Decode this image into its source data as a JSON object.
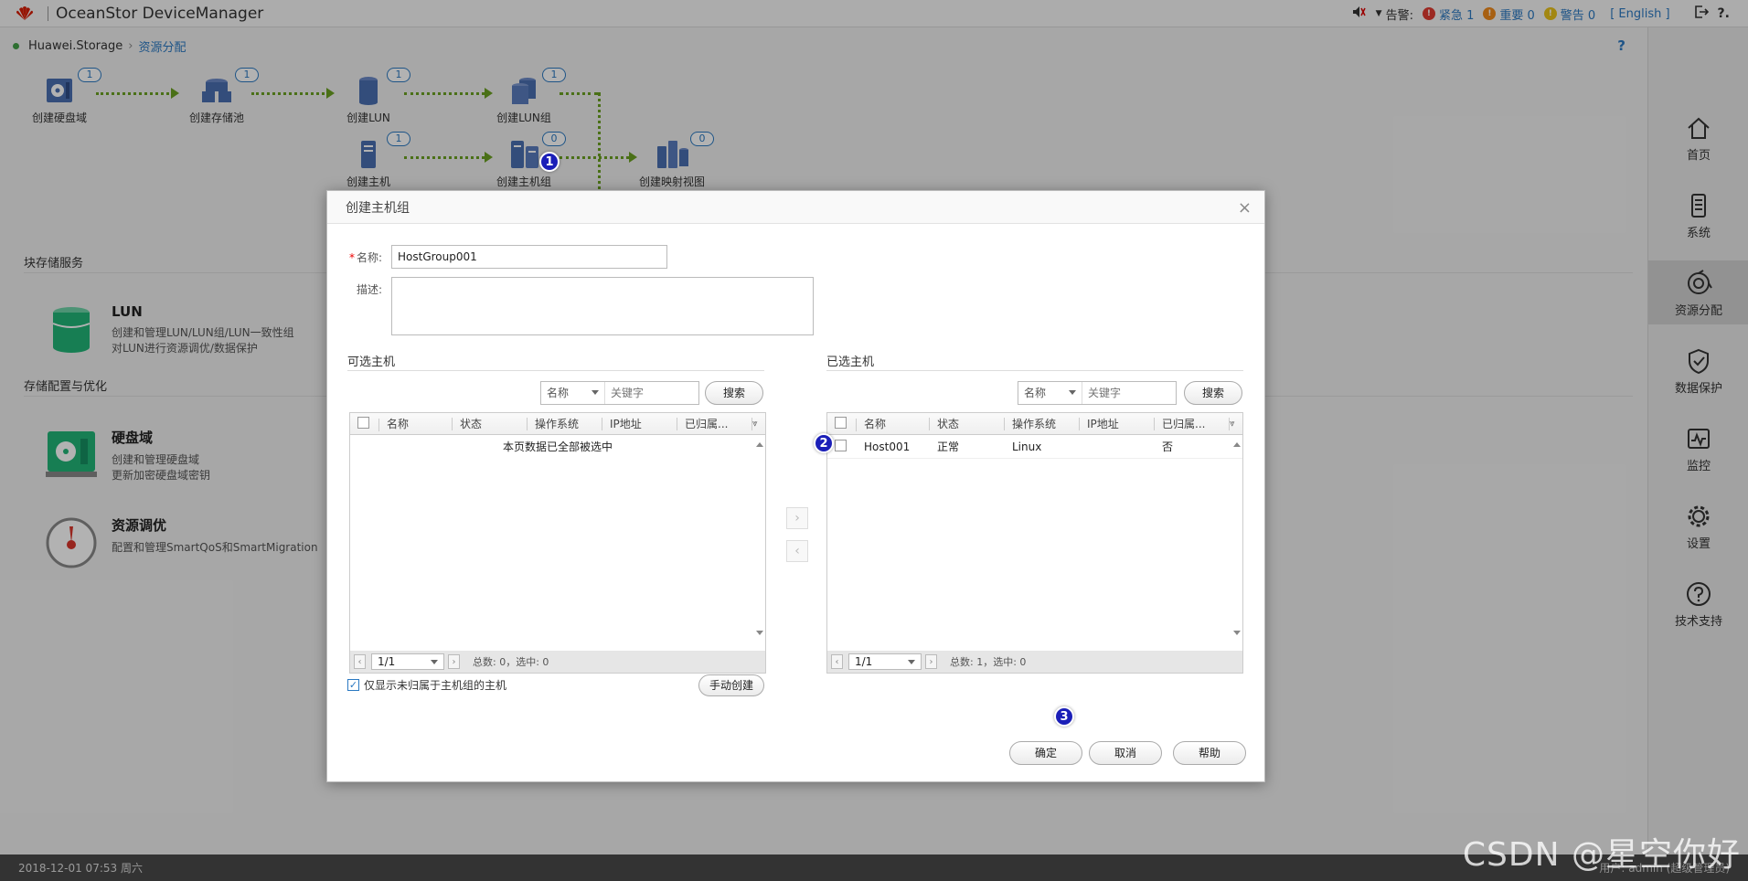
{
  "header": {
    "app_title": "OceanStor DeviceManager",
    "alarm_label": "告警:",
    "critical_label": "紧急 1",
    "major_label": "重要 0",
    "warning_label": "警告 0",
    "language_label": "[ English ]"
  },
  "breadcrumb": {
    "root": "Huawei.Storage",
    "current": "资源分配",
    "help": "?"
  },
  "flow": {
    "nodes": [
      {
        "label": "创建硬盘域",
        "count": "1"
      },
      {
        "label": "创建存储池",
        "count": "1"
      },
      {
        "label": "创建LUN",
        "count": "1"
      },
      {
        "label": "创建LUN组",
        "count": "1"
      },
      {
        "label": "创建主机",
        "count": "1"
      },
      {
        "label": "创建主机组",
        "count": "0"
      },
      {
        "label": "创建映射视图",
        "count": "0"
      }
    ]
  },
  "services": {
    "block_title": "块存储服务",
    "lun_name": "LUN",
    "lun_desc1": "创建和管理LUN/LUN组/LUN一致性组",
    "lun_desc2": "对LUN进行资源调优/数据保护",
    "config_title": "存储配置与优化",
    "disk_name": "硬盘域",
    "disk_desc1": "创建和管理硬盘域",
    "disk_desc2": "更新加密硬盘域密钥",
    "tune_name": "资源调优",
    "tune_desc1": "配置和管理SmartQoS和SmartMigration"
  },
  "sidebar": {
    "items": [
      {
        "label": "首页"
      },
      {
        "label": "系统"
      },
      {
        "label": "资源分配"
      },
      {
        "label": "数据保护"
      },
      {
        "label": "监控"
      },
      {
        "label": "设置"
      },
      {
        "label": "技术支持"
      }
    ]
  },
  "footer": {
    "datetime": "2018-12-01 07:53 周六",
    "user": "用户: admin (超级管理员)"
  },
  "dialog": {
    "title": "创建主机组",
    "name_label": "名称:",
    "name_value": "HostGroup001",
    "desc_label": "描述:",
    "available_title": "可选主机",
    "selected_title": "已选主机",
    "filter_field": "名称",
    "keyword_placeholder": "关键字",
    "search_btn": "搜索",
    "columns": [
      "名称",
      "状态",
      "操作系统",
      "IP地址",
      "已归属..."
    ],
    "available_empty_msg": "本页数据已全部被选中",
    "available_page": "1/1",
    "available_summary": "总数: 0，选中: 0",
    "selected_rows": [
      {
        "name": "Host001",
        "status": "正常",
        "os": "Linux",
        "ip": "",
        "belongs": "否"
      }
    ],
    "selected_page": "1/1",
    "selected_summary": "总数: 1，选中: 0",
    "only_unassigned_label": "仅显示未归属于主机组的主机",
    "manual_create_btn": "手动创建",
    "ok_btn": "确定",
    "cancel_btn": "取消",
    "help_btn": "帮助",
    "close_glyph": "×"
  },
  "annotations": [
    "1",
    "2",
    "3"
  ],
  "watermark": "CSDN @星空你好",
  "colors": {
    "accent": "#2b79c2",
    "flow_green": "#6aa121",
    "badge_blue": "#1b1fb8"
  }
}
